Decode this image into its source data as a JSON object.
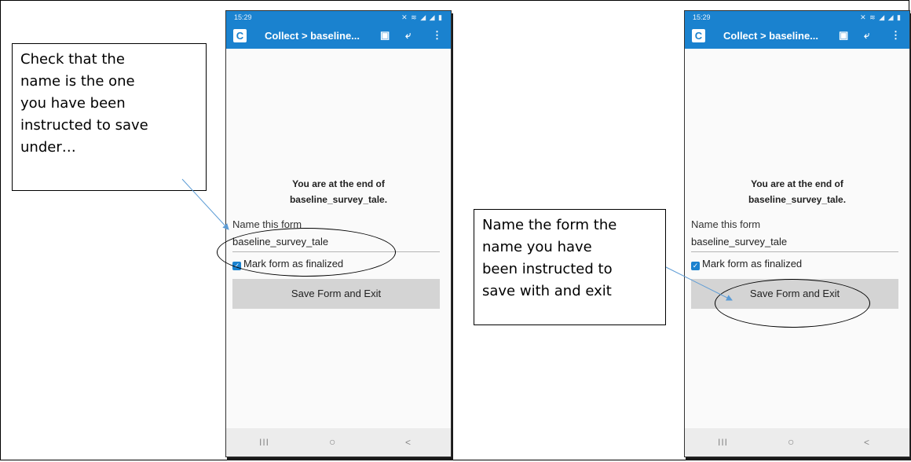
{
  "panels": [
    {
      "status": {
        "time": "15:29",
        "notif_icons": "▬ ▢ ▣ ···",
        "system_icons": "✕ ≋ ◢ ◢ ▮"
      },
      "toolbar": {
        "app_letter": "C",
        "title": "Collect > baseline...",
        "save_icon": "save-icon",
        "nav_icon": "navigate-icon",
        "more_icon": "more-icon"
      },
      "end_line1": "You are at the end of",
      "end_line2": "baseline_survey_tale.",
      "name_label": "Name this form",
      "name_value": "baseline_survey_tale",
      "finalize_label": "Mark form as finalized",
      "finalized": true,
      "save_button": "Save Form and Exit",
      "navbar": {
        "recents": "III",
        "home": "○",
        "back": "<"
      }
    },
    {
      "status": {
        "time": "15:29",
        "notif_icons": "▬ ▢ ▣ ···",
        "system_icons": "✕ ≋ ◢ ◢ ▮"
      },
      "toolbar": {
        "app_letter": "C",
        "title": "Collect > baseline...",
        "save_icon": "save-icon",
        "nav_icon": "navigate-icon",
        "more_icon": "more-icon"
      },
      "end_line1": "You are at the end of",
      "end_line2": "baseline_survey_tale.",
      "name_label": "Name this form",
      "name_value": "baseline_survey_tale",
      "finalize_label": "Mark form as finalized",
      "finalized": true,
      "save_button": "Save Form and Exit",
      "navbar": {
        "recents": "III",
        "home": "○",
        "back": "<"
      }
    }
  ],
  "callouts": {
    "left": "Check that the\nname is the one\nyou have been\ninstructed to save\nunder…",
    "right": "Name the form the\nname you have\nbeen instructed to\nsave with and exit"
  },
  "colors": {
    "accent": "#1a82cf",
    "button": "#d4d4d4",
    "arrow": "#5b9bd5"
  }
}
